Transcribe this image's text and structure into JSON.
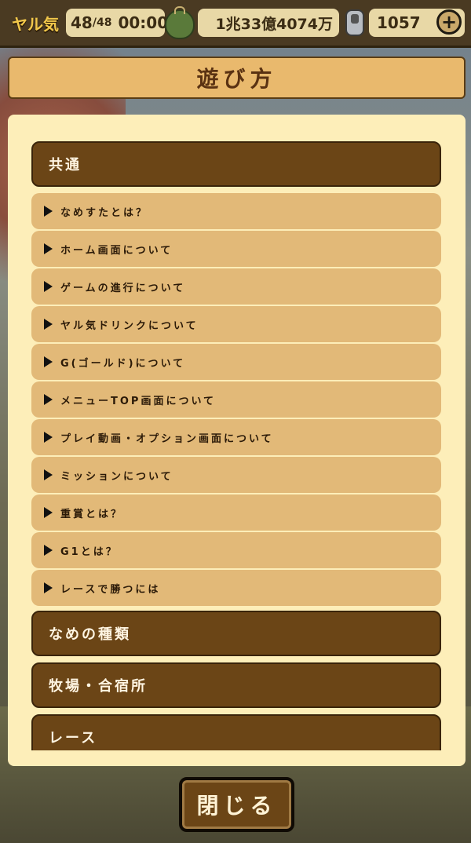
{
  "status_bar": {
    "yaruki_label": "ヤル気",
    "stamina_current": "48",
    "stamina_max": "/48",
    "timer": "00:00",
    "purse_icon": "coin-purse-icon",
    "gold": "1兆33億4074万",
    "drink_icon": "drink-can-icon",
    "drinks": "1057",
    "plus_icon": "plus-icon",
    "plus_symbol": "+"
  },
  "title": "遊び方",
  "sections": [
    {
      "label": "共通",
      "items": [
        "なめすたとは？",
        "ホーム画面について",
        "ゲームの進行について",
        "ヤル気ドリンクについて",
        "G(ゴールド)について",
        "メニューTOP画面について",
        "プレイ動画・オプション画面について",
        "ミッションについて",
        "重賞とは？",
        "G1とは？",
        "レースで勝つには"
      ]
    },
    {
      "label": "なめの種類"
    },
    {
      "label": "牧場・合宿所"
    },
    {
      "label": "レース"
    }
  ],
  "close_button": "閉じる",
  "colors": {
    "panel_bg": "#fdeeb9",
    "header_brown": "#6b4516",
    "item_tan": "#e2b978",
    "title_bg": "#e9b96d"
  }
}
